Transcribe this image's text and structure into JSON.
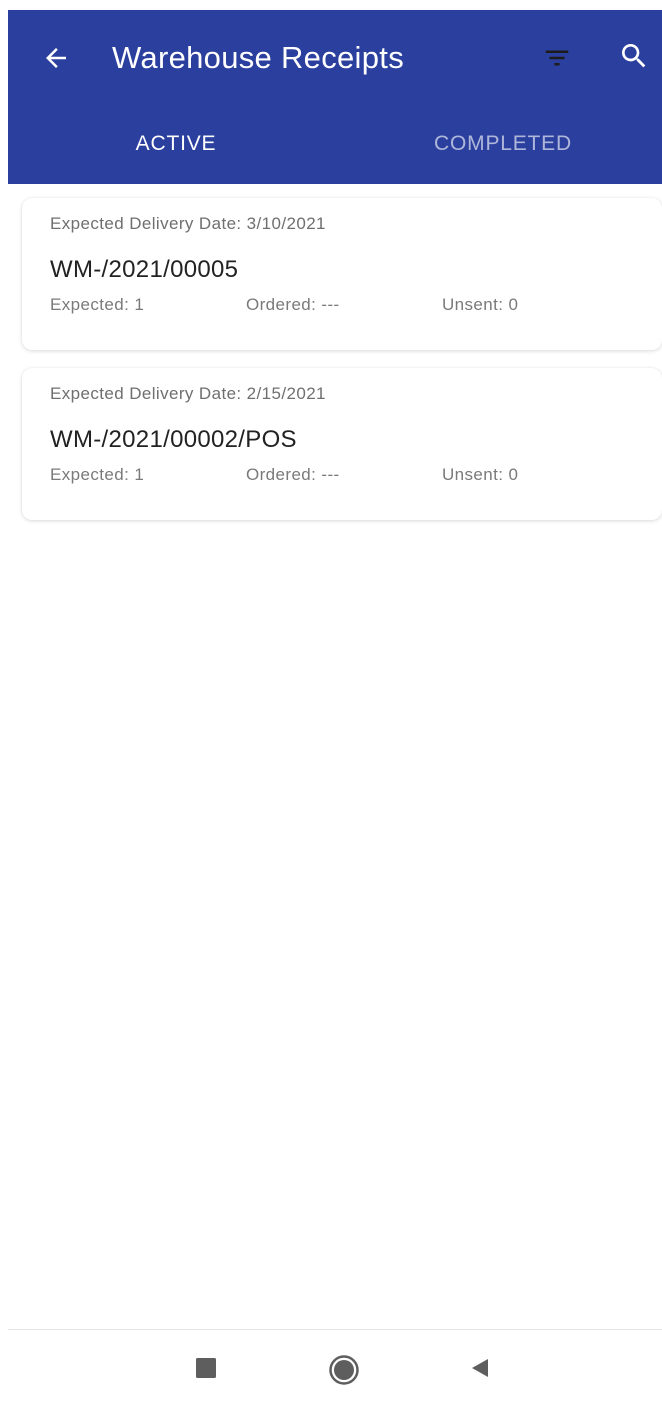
{
  "header": {
    "title": "Warehouse Receipts"
  },
  "tabs": [
    {
      "label": "ACTIVE",
      "selected": true
    },
    {
      "label": "COMPLETED",
      "selected": false
    }
  ],
  "receipts": [
    {
      "date_label": "Expected Delivery Date: 3/10/2021",
      "number": "WM-/2021/00005",
      "expected_label": "Expected: 1",
      "ordered_label": "Ordered: ---",
      "unsent_label": "Unsent: 0"
    },
    {
      "date_label": "Expected Delivery Date: 2/15/2021",
      "number": "WM-/2021/00002/POS",
      "expected_label": "Expected: 1",
      "ordered_label": "Ordered: ---",
      "unsent_label": "Unsent: 0"
    }
  ],
  "icons": {
    "back": "arrow-left-icon",
    "filter": "filter-icon",
    "search": "search-icon",
    "nav_recents": "square-icon",
    "nav_home": "circle-icon",
    "nav_back": "triangle-back-icon"
  },
  "colors": {
    "app_bar": "#2b3f9e",
    "tab_inactive_text": "#a9b2d8",
    "card_meta_text": "#6f6f6f",
    "card_title_text": "#222222"
  }
}
